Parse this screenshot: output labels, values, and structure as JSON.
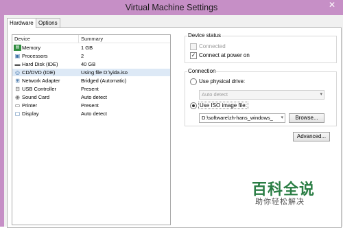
{
  "window": {
    "title": "Virtual Machine Settings",
    "close_glyph": "✕"
  },
  "tabs": [
    {
      "label": "Hardware"
    },
    {
      "label": "Options"
    }
  ],
  "device_list": {
    "headers": {
      "device": "Device",
      "summary": "Summary"
    },
    "rows": [
      {
        "device": "Memory",
        "summary": "1 GB",
        "icon": "memory-icon"
      },
      {
        "device": "Processors",
        "summary": "2",
        "icon": "processor-icon"
      },
      {
        "device": "Hard Disk (IDE)",
        "summary": "40 GB",
        "icon": "hard-disk-icon"
      },
      {
        "device": "CD/DVD (IDE)",
        "summary": "Using file D:\\yida.iso",
        "icon": "cd-dvd-icon"
      },
      {
        "device": "Network Adapter",
        "summary": "Bridged (Automatic)",
        "icon": "network-adapter-icon"
      },
      {
        "device": "USB Controller",
        "summary": "Present",
        "icon": "usb-controller-icon"
      },
      {
        "device": "Sound Card",
        "summary": "Auto detect",
        "icon": "sound-card-icon"
      },
      {
        "device": "Printer",
        "summary": "Present",
        "icon": "printer-icon"
      },
      {
        "device": "Display",
        "summary": "Auto detect",
        "icon": "display-icon"
      }
    ]
  },
  "device_status": {
    "title": "Device status",
    "connected_label": "Connected",
    "connected_checked": false,
    "connect_at_power_on_label": "Connect at power on",
    "connect_at_power_on_checked": true
  },
  "connection": {
    "title": "Connection",
    "physical_drive_label": "Use physical drive:",
    "physical_drive_value": "Auto detect",
    "iso_label": "Use ISO image file:",
    "iso_value": "D:\\software\\zh-hans_windows_",
    "browse_label": "Browse..."
  },
  "advanced_label": "Advanced...",
  "watermark": {
    "main": "百科全说",
    "sub": "助你轻松解决"
  }
}
